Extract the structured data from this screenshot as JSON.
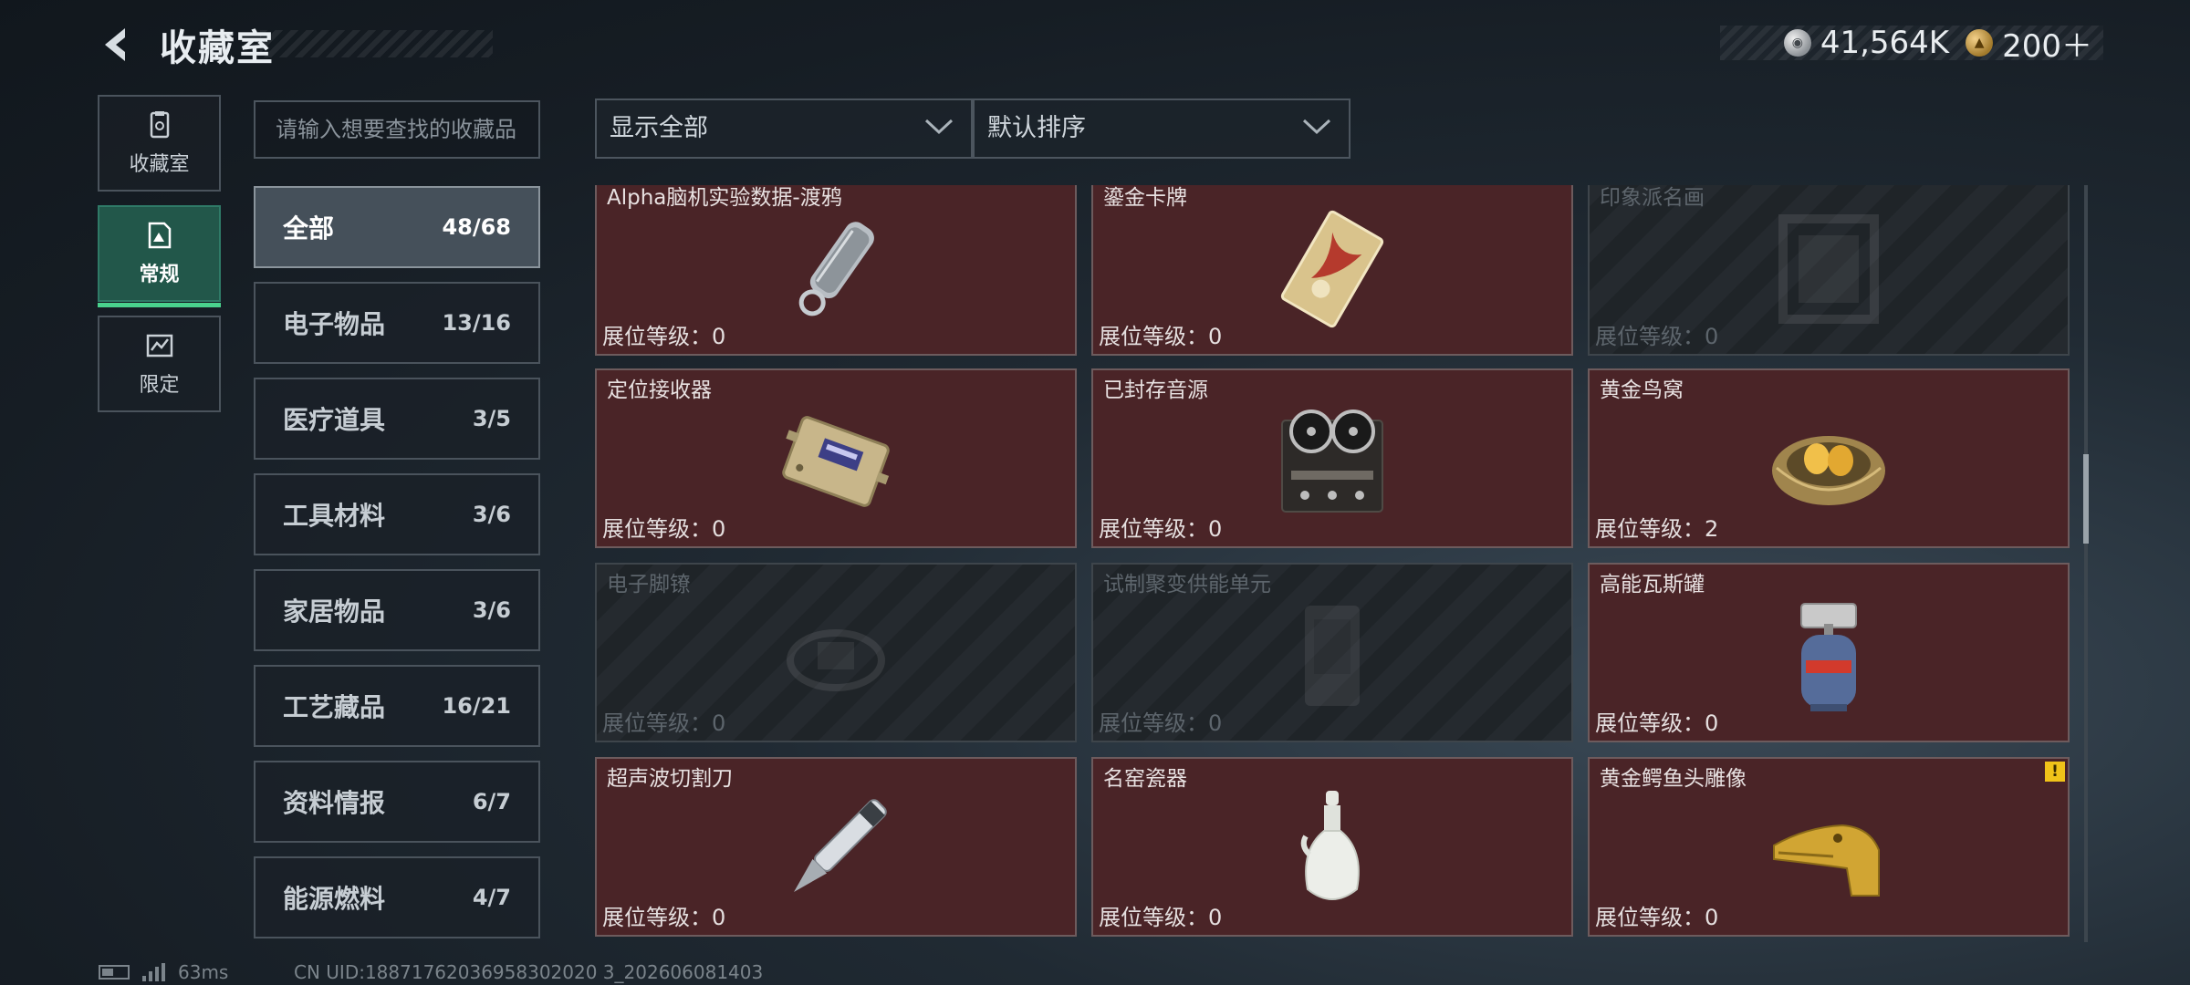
{
  "header": {
    "title": "收藏室",
    "currencies": [
      {
        "icon": "silver-coin-icon",
        "value": "41,564K"
      },
      {
        "icon": "gold-coin-icon",
        "value": "200＋"
      }
    ]
  },
  "rail": {
    "items": [
      {
        "label": "收藏室",
        "icon": "collection-room-icon",
        "active": false
      },
      {
        "label": "常规",
        "icon": "regular-icon",
        "active": true
      },
      {
        "label": "限定",
        "icon": "limited-icon",
        "active": false
      }
    ]
  },
  "search": {
    "placeholder": "请输入想要查找的收藏品"
  },
  "filters": {
    "display": {
      "value": "显示全部"
    },
    "sort": {
      "value": "默认排序"
    }
  },
  "categories": [
    {
      "name": "全部",
      "count": "48/68",
      "active": true
    },
    {
      "name": "电子物品",
      "count": "13/16"
    },
    {
      "name": "医疗道具",
      "count": "3/5"
    },
    {
      "name": "工具材料",
      "count": "3/6"
    },
    {
      "name": "家居物品",
      "count": "3/6"
    },
    {
      "name": "工艺藏品",
      "count": "16/21"
    },
    {
      "name": "资料情报",
      "count": "6/7"
    },
    {
      "name": "能源燃料",
      "count": "4/7"
    }
  ],
  "level_prefix": "展位等级：",
  "items": [
    {
      "name": "Alpha脑机实验数据-渡鸦",
      "level": "0",
      "owned": true,
      "icon": "flash-drive-keychain-icon"
    },
    {
      "name": "鎏金卡牌",
      "level": "0",
      "owned": true,
      "icon": "gilded-card-icon"
    },
    {
      "name": "印象派名画",
      "level": "0",
      "owned": false,
      "icon": "painting-frame-icon"
    },
    {
      "name": "定位接收器",
      "level": "0",
      "owned": true,
      "icon": "locator-receiver-icon"
    },
    {
      "name": "已封存音源",
      "level": "0",
      "owned": true,
      "icon": "reel-tape-recorder-icon"
    },
    {
      "name": "黄金鸟窝",
      "level": "2",
      "owned": true,
      "icon": "golden-nest-icon"
    },
    {
      "name": "电子脚镣",
      "level": "0",
      "owned": false,
      "icon": "ankle-monitor-icon"
    },
    {
      "name": "试制聚变供能单元",
      "level": "0",
      "owned": false,
      "icon": "fusion-cell-icon"
    },
    {
      "name": "高能瓦斯罐",
      "level": "0",
      "owned": true,
      "icon": "gas-canister-icon"
    },
    {
      "name": "超声波切割刀",
      "level": "0",
      "owned": true,
      "icon": "ultrasonic-knife-icon"
    },
    {
      "name": "名窑瓷器",
      "level": "0",
      "owned": true,
      "icon": "porcelain-vase-icon"
    },
    {
      "name": "黄金鳄鱼头雕像",
      "level": "0",
      "owned": true,
      "icon": "golden-crocodile-head-icon",
      "badge": "!"
    }
  ],
  "status": {
    "ping": "63ms",
    "uid": "CN UID:18871762036958302020 3_202606081403"
  }
}
